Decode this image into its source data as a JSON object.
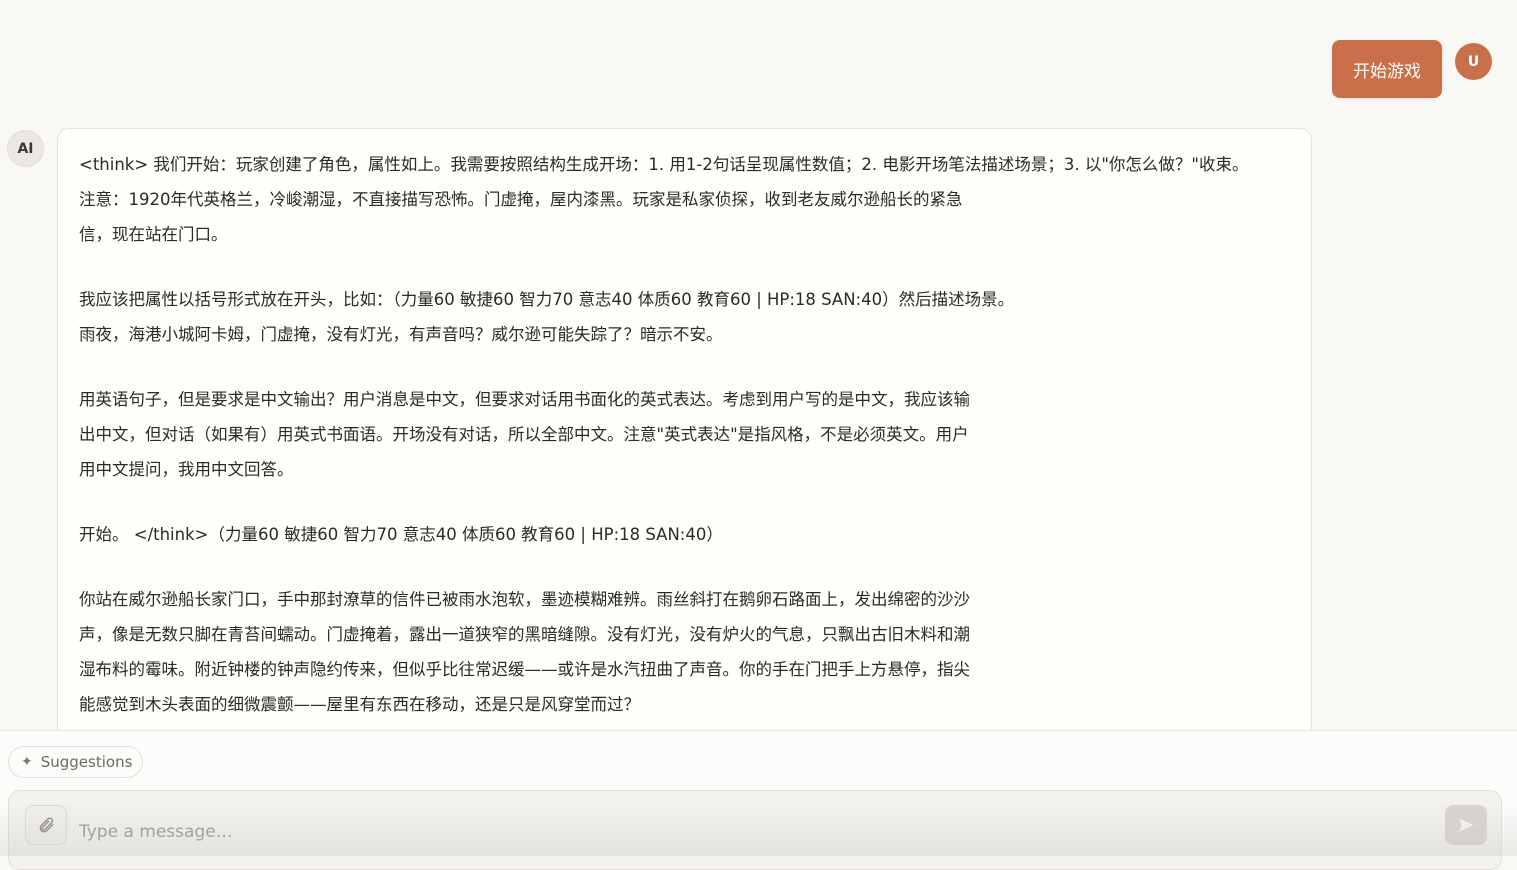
{
  "user_message": {
    "text": "开始游戏",
    "avatar_letter": "U"
  },
  "ai_message": {
    "avatar_label": "AI",
    "paragraphs": [
      {
        "lines": [
          "<think> 我们开始：玩家创建了角色，属性如上。我需要按照结构生成开场：1. 用1-2句话呈现属性数值；2. 电影开场笔法描述场景；3. 以\"你怎么做？\"收束。",
          "注意：1920年代英格兰，冷峻潮湿，不直接描写恐怖。门虚掩，屋内漆黑。玩家是私家侦探，收到老友威尔逊船长的紧急",
          "信，现在站在门口。"
        ]
      },
      {
        "lines": [
          "我应该把属性以括号形式放在开头，比如：（力量60 敏捷60 智力70 意志40 体质60 教育60 | HP:18 SAN:40）然后描述场景。",
          "雨夜，海港小城阿卡姆，门虚掩，没有灯光，有声音吗？威尔逊可能失踪了？暗示不安。"
        ]
      },
      {
        "lines": [
          "用英语句子，但是要求是中文输出？用户消息是中文，但要求对话用书面化的英式表达。考虑到用户写的是中文，我应该输",
          "出中文，但对话（如果有）用英式书面语。开场没有对话，所以全部中文。注意\"英式表达\"是指风格，不是必须英文。用户",
          "用中文提问，我用中文回答。"
        ]
      },
      {
        "lines": [
          "开始。 </think>（力量60 敏捷60 智力70 意志40 体质60 教育60 | HP:18 SAN:40）"
        ]
      },
      {
        "lines": [
          "你站在威尔逊船长家门口，手中那封潦草的信件已被雨水泡软，墨迹模糊难辨。雨丝斜打在鹅卵石路面上，发出绵密的沙沙",
          "声，像是无数只脚在青苔间蠕动。门虚掩着，露出一道狭窄的黑暗缝隙。没有灯光，没有炉火的气息，只飘出古旧木料和潮",
          "湿布料的霉味。附近钟楼的钟声隐约传来，但似乎比往常迟缓——或许是水汽扭曲了声音。你的手在门把手上方悬停，指尖",
          "能感觉到木头表面的细微震颤——屋里有东西在移动，还是只是风穿堂而过？"
        ]
      }
    ]
  },
  "composer": {
    "suggestions_label": "Suggestions",
    "input_value": "",
    "input_placeholder": "Type a message…"
  },
  "icons": {
    "sparkle": "sparkle-icon",
    "attach": "paperclip-icon",
    "send": "send-icon"
  },
  "colors": {
    "accent": "#c96f49",
    "background": "#f9f8f5",
    "bubble": "#fffefb"
  }
}
